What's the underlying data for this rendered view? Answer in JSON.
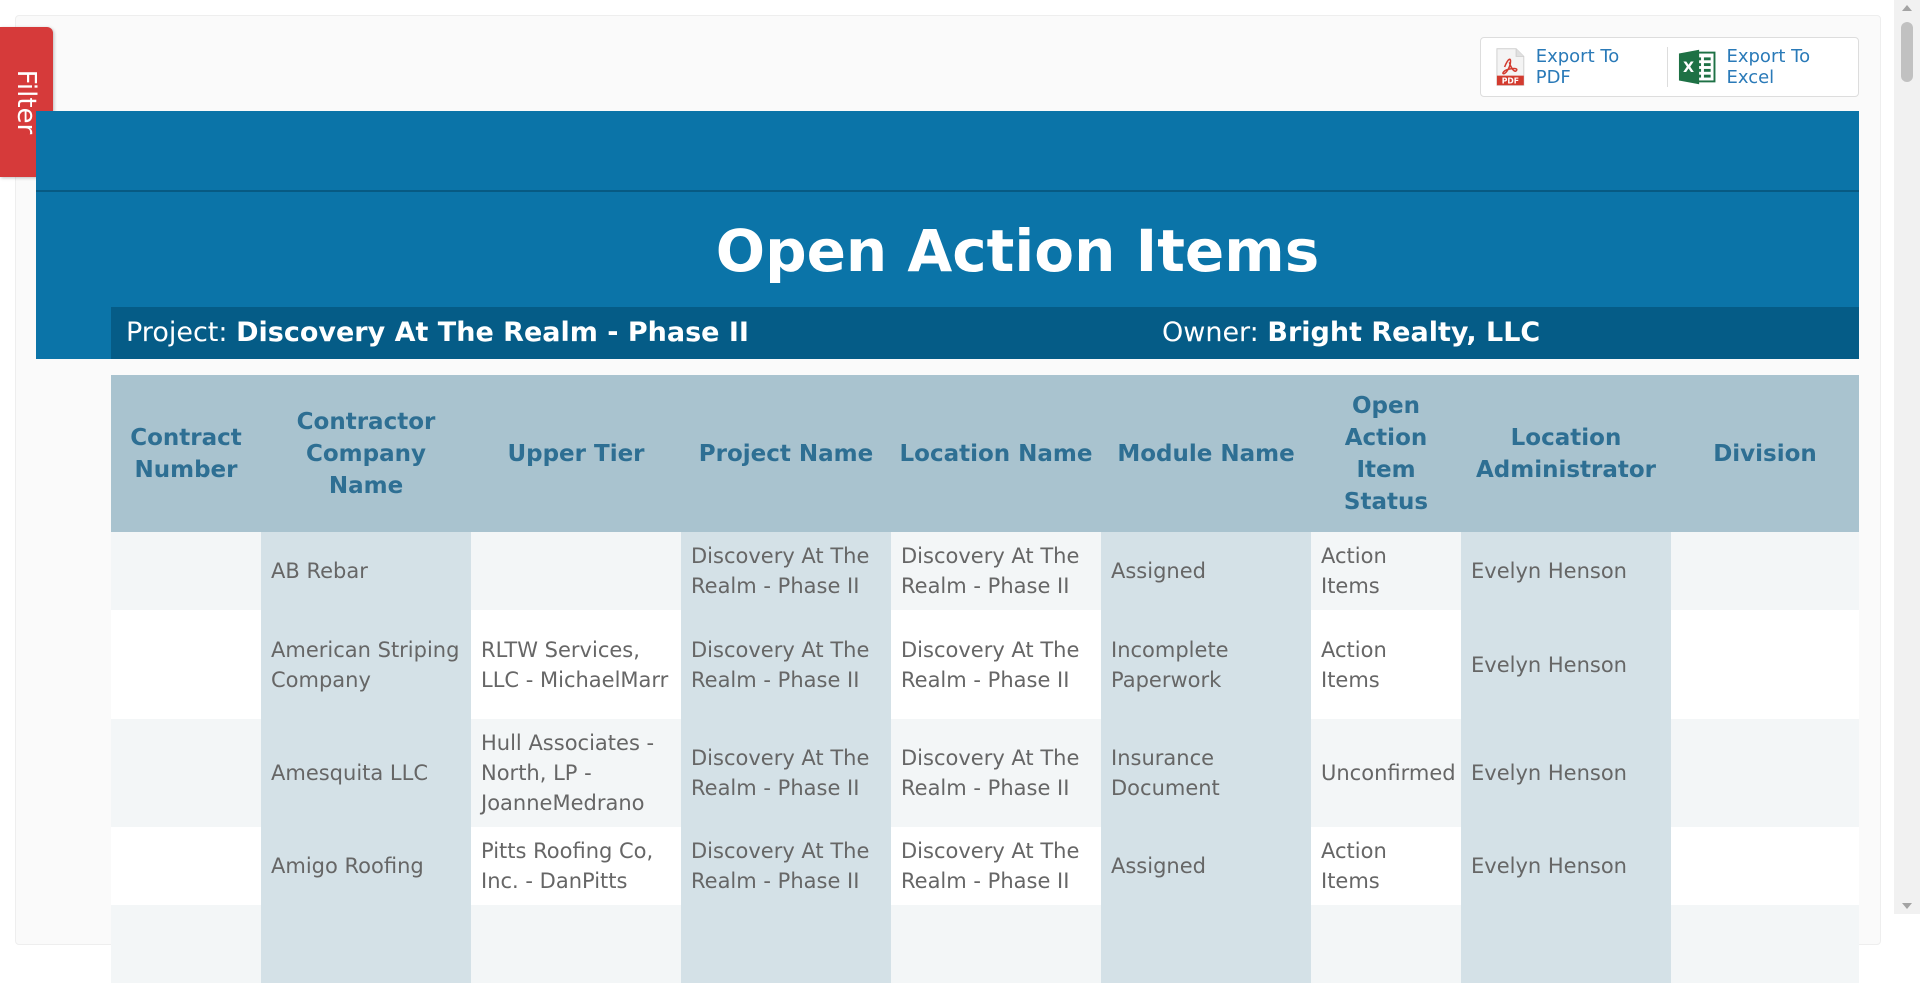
{
  "filter": {
    "label": "Filter"
  },
  "export": {
    "pdf_label": "Export To PDF",
    "excel_label": "Export To Excel"
  },
  "report": {
    "title": "Open Action Items",
    "project_label": "Project:",
    "project_value": "Discovery At The Realm - Phase II",
    "owner_label": "Owner:",
    "owner_value": "Bright Realty, LLC"
  },
  "table": {
    "headers": [
      "Contract Number",
      "Contractor Company Name",
      "Upper Tier",
      "Project Name",
      "Location Name",
      "Module Name",
      "Open Action Item Status",
      "Location Administrator",
      "Division"
    ],
    "rows": [
      [
        "",
        "AB Rebar",
        "",
        "Discovery At The Realm - Phase II",
        "Discovery At The Realm - Phase II",
        "Assigned",
        "Action Items",
        "Evelyn Henson",
        ""
      ],
      [
        "",
        "American Striping Company",
        "RLTW Services, LLC - MichaelMarr",
        "Discovery At The Realm - Phase II",
        "Discovery At The Realm - Phase II",
        "Incomplete Paperwork",
        "Action Items",
        "Evelyn Henson",
        ""
      ],
      [
        "",
        "Amesquita LLC",
        "Hull Associates - North, LP - JoanneMedrano",
        "Discovery At The Realm - Phase II",
        "Discovery At The Realm - Phase II",
        "Insurance Document",
        "Unconfirmed",
        "Evelyn Henson",
        ""
      ],
      [
        "",
        "Amigo Roofing",
        "Pitts Roofing Co, Inc. - DanPitts",
        "Discovery At The Realm - Phase II",
        "Discovery At The Realm - Phase II",
        "Assigned",
        "Action Items",
        "Evelyn Henson",
        ""
      ],
      [
        "",
        "",
        "",
        "",
        "",
        "",
        "",
        "",
        ""
      ]
    ]
  },
  "colors": {
    "banner": "#0b74a8",
    "info_bar": "#055c87",
    "header_bg": "#a9c3cf",
    "header_text": "#2e6f93",
    "filter_tab": "#d63a3a",
    "export_link": "#2a7ab8"
  },
  "icons": {
    "pdf": "pdf-file-icon",
    "excel": "excel-file-icon"
  }
}
